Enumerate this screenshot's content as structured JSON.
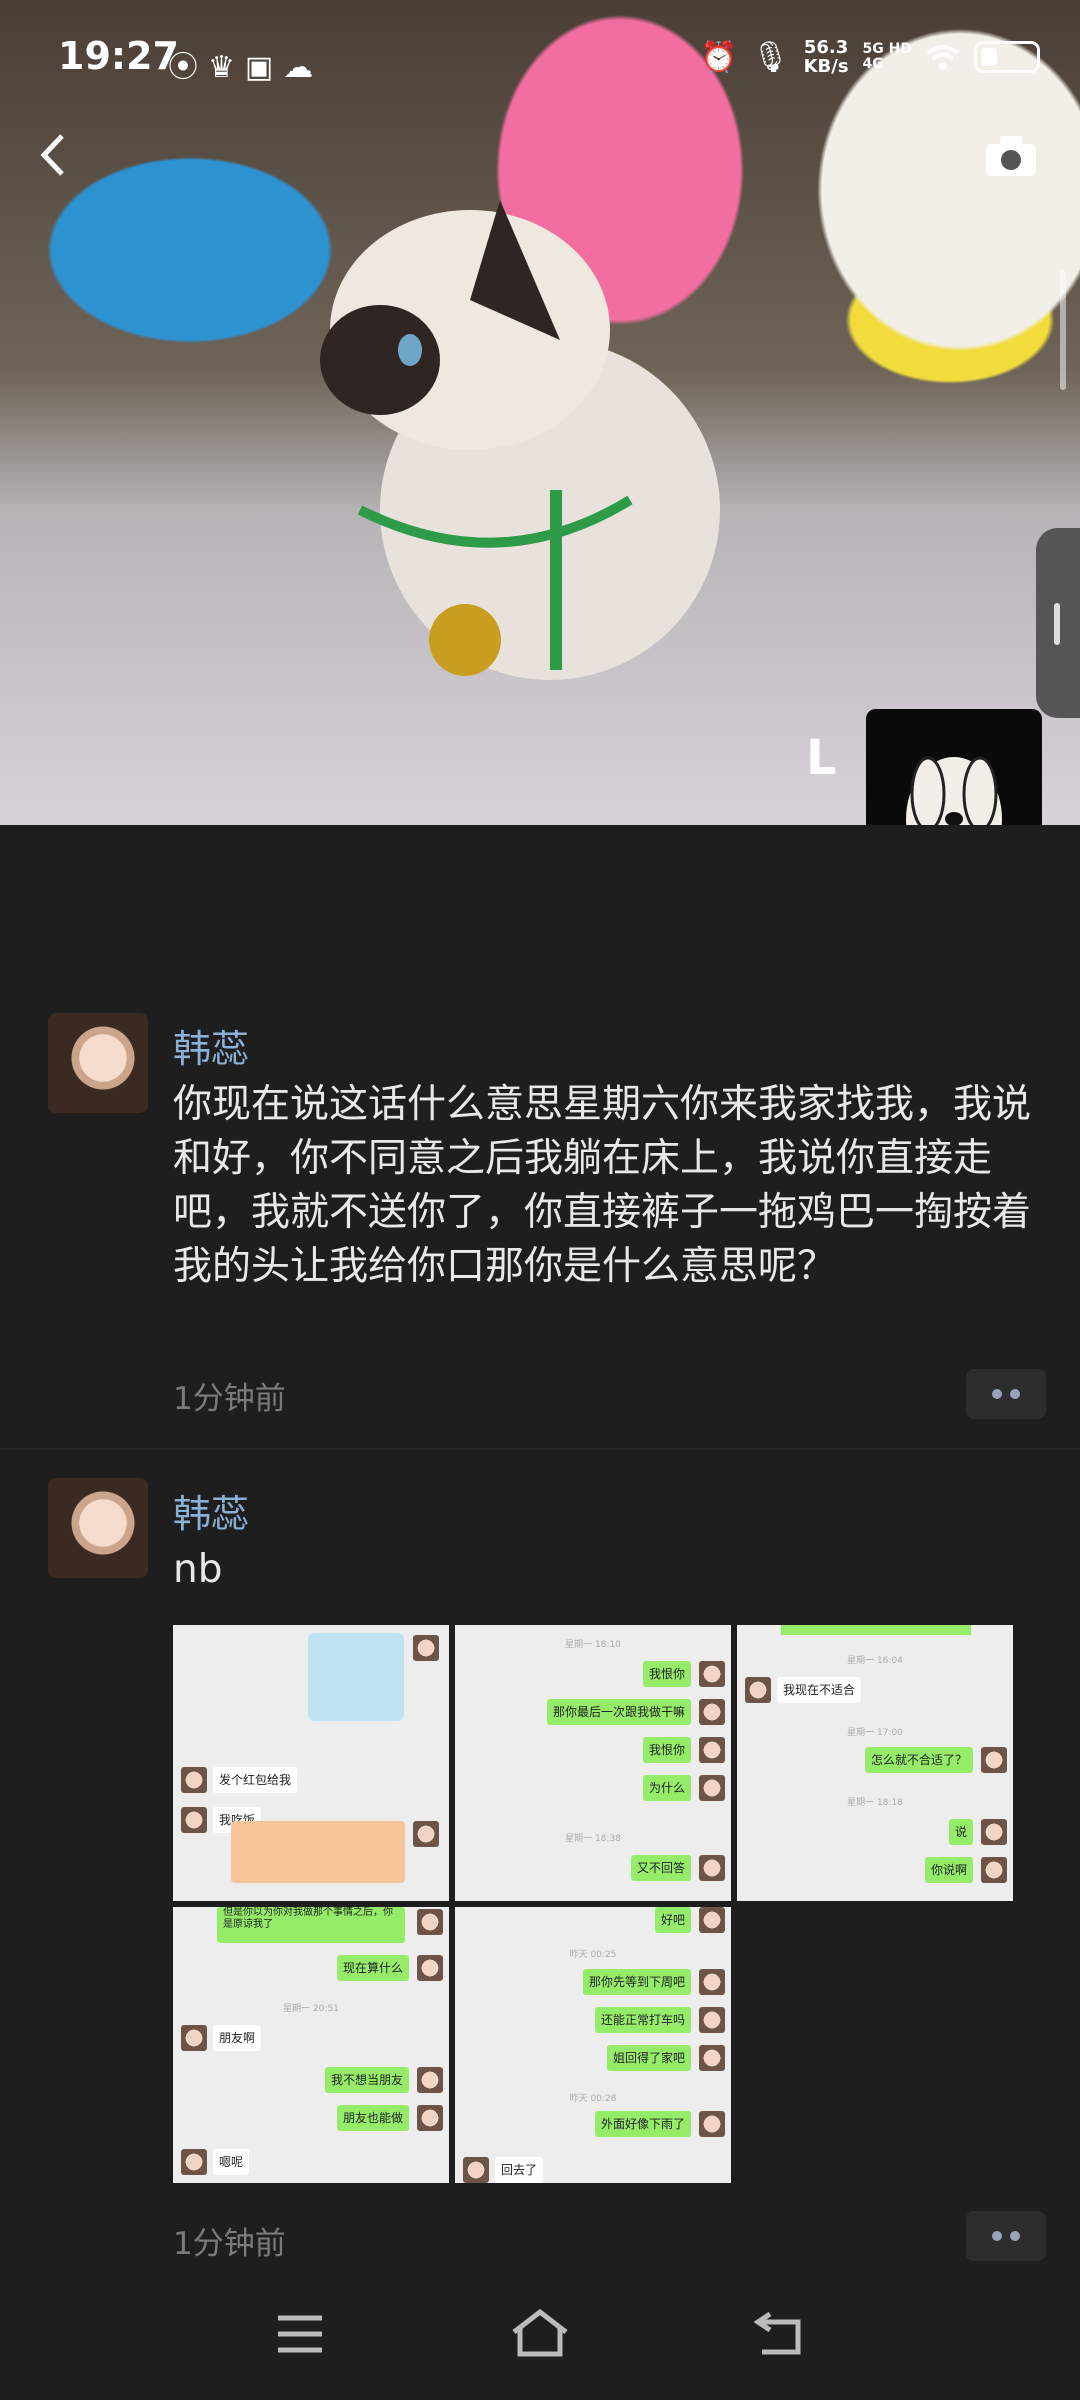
{
  "status_bar": {
    "time": "19:27",
    "left_icons": [
      "wechat-icon",
      "crown-icon",
      "app-icon",
      "cloud-icon"
    ],
    "right_icons": [
      "alarm-icon",
      "mic-icon"
    ],
    "net_speed_value": "56.3",
    "net_speed_unit": "KB/s",
    "signal_label": "5G HD",
    "signal_label2": "4G",
    "wifi_icon": "wifi-icon",
    "battery_icon": "battery-icon"
  },
  "header": {
    "back_icon": "chevron-left-icon",
    "camera_icon": "camera-icon",
    "cover_letter": "L"
  },
  "posts": [
    {
      "author": "韩蕊",
      "text": "你现在说这话什么意思星期六你来我家找我，我说和好，你不同意之后我躺在床上，我说你直接走吧，我就不送你了，你直接裤子一拖鸡巴一掏按着我的头让我给你口那你是什么意思呢？",
      "time": "1分钟前"
    },
    {
      "author": "韩蕊",
      "text": "nb",
      "time": "1分钟前",
      "images": [
        {
          "bubbles": [
            "发个红包给我",
            "我吃饭"
          ]
        },
        {
          "timestamps": [
            "星期一 18:10",
            "星期一 18:38"
          ],
          "bubbles": [
            "我恨你",
            "那你最后一次跟我做干嘛",
            "我恨你",
            "为什么",
            "又不回答"
          ]
        },
        {
          "timestamps": [
            "星期一 16:04",
            "星期一 17:00",
            "星期一 18:18"
          ],
          "bubbles": [
            "我现在不适合",
            "怎么就不合适了？",
            "说",
            "你说啊"
          ]
        },
        {
          "timestamps": [
            "星期一 20:51"
          ],
          "bubbles": [
            "但是你以为你对我做那个事情之后，你是原谅我了",
            "现在算什么",
            "朋友啊",
            "我不想当朋友",
            "朋友也能做",
            "嗯呢"
          ]
        },
        {
          "timestamps": [
            "昨天 00:25",
            "昨天 00:28"
          ],
          "bubbles": [
            "好吧",
            "那你先等到下周吧",
            "还能正常打车吗",
            "姐回得了家吧",
            "外面好像下雨了",
            "回去了"
          ]
        }
      ]
    }
  ],
  "nav_bar": {
    "icons": [
      "menu-icon",
      "home-icon",
      "back-icon"
    ]
  }
}
